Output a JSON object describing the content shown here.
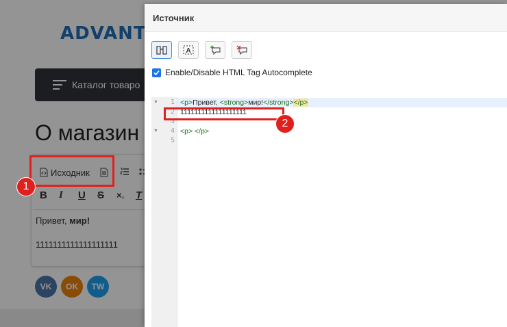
{
  "background": {
    "logo": "ADVANT",
    "catalog_label": "Каталог товаро",
    "page_title": "О магазин",
    "editor": {
      "source_label": "Исходник",
      "content_text": "Привет, ",
      "content_bold": "мир!",
      "content_line2": "1111111111111111111"
    },
    "social": [
      "VK",
      "OK",
      "TW"
    ]
  },
  "dialog": {
    "title": "Источник",
    "checkbox_label": "Enable/Disable HTML Tag Autocomplete",
    "checkbox_checked": true,
    "line_numbers": [
      "1",
      "2",
      "3",
      "4",
      "5"
    ],
    "code": {
      "l1": {
        "t1": "<p>",
        "t2": "Привет, ",
        "t3": "<strong>",
        "t4": "мир!",
        "t5": "</strong>",
        "t6": "</p>"
      },
      "l2": "1111111111111111111",
      "l4": {
        "t1": "<p>",
        "t2": " ",
        "t3": "</p>"
      }
    }
  },
  "annotations": {
    "badge1": "1",
    "badge2": "2"
  },
  "colors": {
    "annotation_red": "#e0201c",
    "tag_green": "#1a6e1a",
    "overlay": "rgba(0,0,0,0.42)"
  }
}
